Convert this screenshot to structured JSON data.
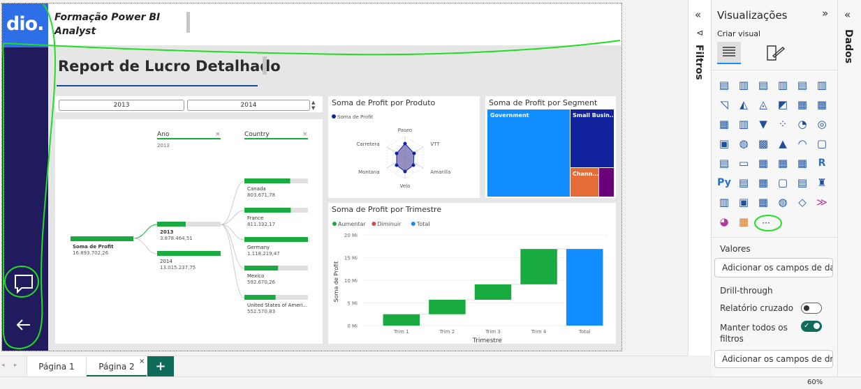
{
  "header": {
    "title_line1": "Formação Power BI",
    "title_line2": "Analyst",
    "logo_text": "dio."
  },
  "page_heading": "Report de Lucro Detalhado",
  "slicer": {
    "options": [
      "2013",
      "2014"
    ]
  },
  "decomposition_tree": {
    "root_label": "Soma de Profit",
    "root_value": "16.893.702,26",
    "level1_header": "Ano",
    "level1_filter": "2013",
    "level2_header": "Country",
    "years": [
      {
        "label": "2013",
        "value": "3.878.464,51",
        "fraction": 0.45
      },
      {
        "label": "2014",
        "value": "13.015.237,75",
        "fraction": 1.0
      }
    ],
    "countries": [
      {
        "label": "Canada",
        "value": "803.671,78",
        "fraction": 0.72
      },
      {
        "label": "France",
        "value": "811.332,17",
        "fraction": 0.73
      },
      {
        "label": "Germany",
        "value": "1.118.219,47",
        "fraction": 1.0
      },
      {
        "label": "Mexico",
        "value": "592.670,26",
        "fraction": 0.53
      },
      {
        "label": "United States of Ameri...",
        "value": "552.570,83",
        "fraction": 0.49
      }
    ]
  },
  "radar": {
    "title": "Soma de Profit por Produto",
    "legend": "Soma de Profit",
    "axes": [
      "Paseo",
      "VTT",
      "Amarilla",
      "Velo",
      "Montana",
      "Carretera"
    ]
  },
  "treemap": {
    "title": "Soma de Profit por Segment",
    "items": [
      {
        "label": "Government",
        "color": "#118dff"
      },
      {
        "label": "Small Busin...",
        "color": "#12239e"
      },
      {
        "label": "Chann...",
        "color": "#e66c37"
      },
      {
        "label": "",
        "color": "#6b007b"
      }
    ]
  },
  "chart_data": {
    "type": "bar",
    "title": "Soma de Profit por Trimestre",
    "xlabel": "Trimestre",
    "ylabel": "Soma de Profit",
    "categories": [
      "Trim 1",
      "Trim 2",
      "Trim 3",
      "Trim 4",
      "Total"
    ],
    "ticks": [
      "0 Mi",
      "5 Mi",
      "10 Mi",
      "15 Mi",
      "20 Mi"
    ],
    "ylim": [
      0,
      20
    ],
    "legend": [
      {
        "name": "Aumentar",
        "color": "#1aab40"
      },
      {
        "name": "Diminuir",
        "color": "#d64550"
      },
      {
        "name": "Total",
        "color": "#118dff"
      }
    ],
    "waterfall": [
      {
        "category": "Trim 1",
        "start": 0,
        "end": 2.5,
        "kind": "Aumentar"
      },
      {
        "category": "Trim 2",
        "start": 2.5,
        "end": 5.7,
        "kind": "Aumentar"
      },
      {
        "category": "Trim 3",
        "start": 5.7,
        "end": 9.1,
        "kind": "Aumentar"
      },
      {
        "category": "Trim 4",
        "start": 9.1,
        "end": 16.9,
        "kind": "Aumentar"
      },
      {
        "category": "Total",
        "start": 0,
        "end": 16.9,
        "kind": "Total"
      }
    ]
  },
  "filters_pane": {
    "label": "Filtros"
  },
  "viz_pane": {
    "title": "Visualizações",
    "subtitle": "Criar visual",
    "more": "···",
    "values_label": "Valores",
    "values_placeholder": "Adicionar os campos de da...",
    "drill_label": "Drill-through",
    "cross_report_label": "Relatório cruzado",
    "keep_filters_label": "Manter todos os filtros",
    "drill_placeholder": "Adicionar os campos de dr..."
  },
  "data_pane": {
    "label": "Dados"
  },
  "tabs": {
    "page1": "Página 1",
    "page2": "Página 2",
    "add": "+"
  },
  "status": {
    "zoom": "60%"
  }
}
